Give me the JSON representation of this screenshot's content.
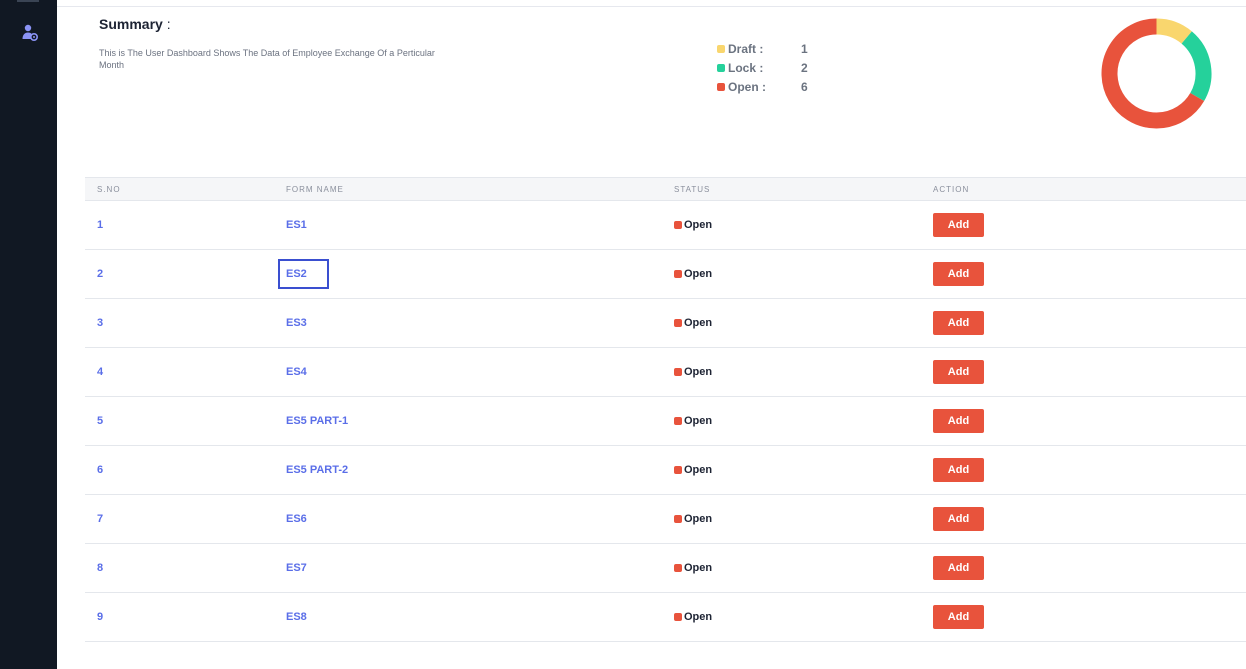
{
  "summary": {
    "title": "Summary",
    "colon": " :",
    "description": "This is The User Dashboard Shows The Data of Employee Exchange Of a Perticular Month"
  },
  "legend": [
    {
      "label": "Draft :",
      "value": "1",
      "color": "#f9d66e"
    },
    {
      "label": "Lock :",
      "value": "2",
      "color": "#25d19b"
    },
    {
      "label": "Open :",
      "value": "6",
      "color": "#e8533c"
    }
  ],
  "table": {
    "headers": {
      "sno": "S.NO",
      "form_name": "FORM NAME",
      "status": "STATUS",
      "action": "ACTION"
    },
    "rows": [
      {
        "sno": "1",
        "form": "ES1",
        "status": "Open",
        "action": "Add"
      },
      {
        "sno": "2",
        "form": "ES2",
        "status": "Open",
        "action": "Add"
      },
      {
        "sno": "3",
        "form": "ES3",
        "status": "Open",
        "action": "Add"
      },
      {
        "sno": "4",
        "form": "ES4",
        "status": "Open",
        "action": "Add"
      },
      {
        "sno": "5",
        "form": "ES5 PART-1",
        "status": "Open",
        "action": "Add"
      },
      {
        "sno": "6",
        "form": "ES5 PART-2",
        "status": "Open",
        "action": "Add"
      },
      {
        "sno": "7",
        "form": "ES6",
        "status": "Open",
        "action": "Add"
      },
      {
        "sno": "8",
        "form": "ES7",
        "status": "Open",
        "action": "Add"
      },
      {
        "sno": "9",
        "form": "ES8",
        "status": "Open",
        "action": "Add"
      }
    ]
  },
  "sidebar": {
    "icon": "user-settings-icon"
  },
  "colors": {
    "sidebar_bg": "#111823",
    "accent": "#5a6ee8",
    "open": "#e8533c",
    "draft": "#f9d66e",
    "lock": "#25d19b",
    "highlight_border": "#3a4fd0"
  }
}
